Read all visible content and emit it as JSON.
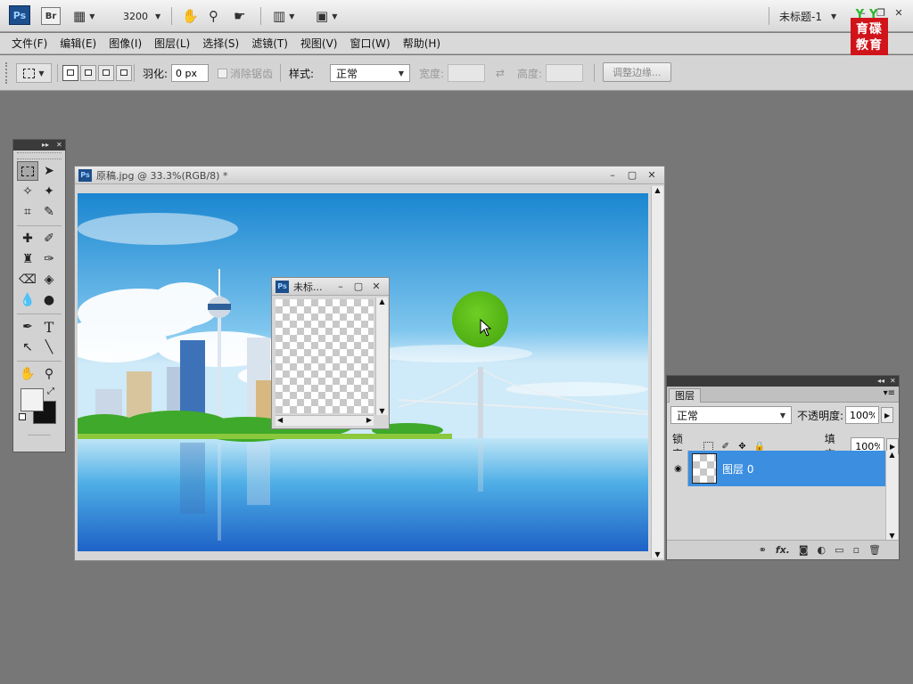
{
  "appbar": {
    "ps_label": "Ps",
    "br_label": "Br",
    "zoom": "3200",
    "doc_title": "未标题-1",
    "win_min": "–",
    "win_restore": "❐",
    "win_close": "✕"
  },
  "brand": {
    "line1": "育碟",
    "line2": "教育"
  },
  "menu": [
    "文件(F)",
    "编辑(E)",
    "图像(I)",
    "图层(L)",
    "选择(S)",
    "滤镜(T)",
    "视图(V)",
    "窗口(W)",
    "帮助(H)"
  ],
  "options": {
    "feather_label": "羽化:",
    "feather_value": "0 px",
    "antialias_label": "消除锯齿",
    "style_label": "样式:",
    "style_value": "正常",
    "width_label": "宽度:",
    "height_label": "高度:",
    "refine_edge": "调整边缘..."
  },
  "docwin_main": {
    "title": "原稿.jpg @ 33.3%(RGB/8) *",
    "ps_label": "Ps"
  },
  "docwin_small": {
    "title": "未标...",
    "ps_label": "Ps"
  },
  "layers_panel": {
    "tab": "图层",
    "blend_mode": "正常",
    "opacity_label": "不透明度:",
    "opacity_value": "100%",
    "lock_label": "锁定:",
    "fill_label": "填充:",
    "fill_value": "100%",
    "layer_name": "图层 0",
    "footer_fx": "fx."
  },
  "colors": {
    "accent": "#3b8ee0",
    "ps_blue": "#1c4f8c",
    "cursor_highlight": "#4caf10"
  }
}
